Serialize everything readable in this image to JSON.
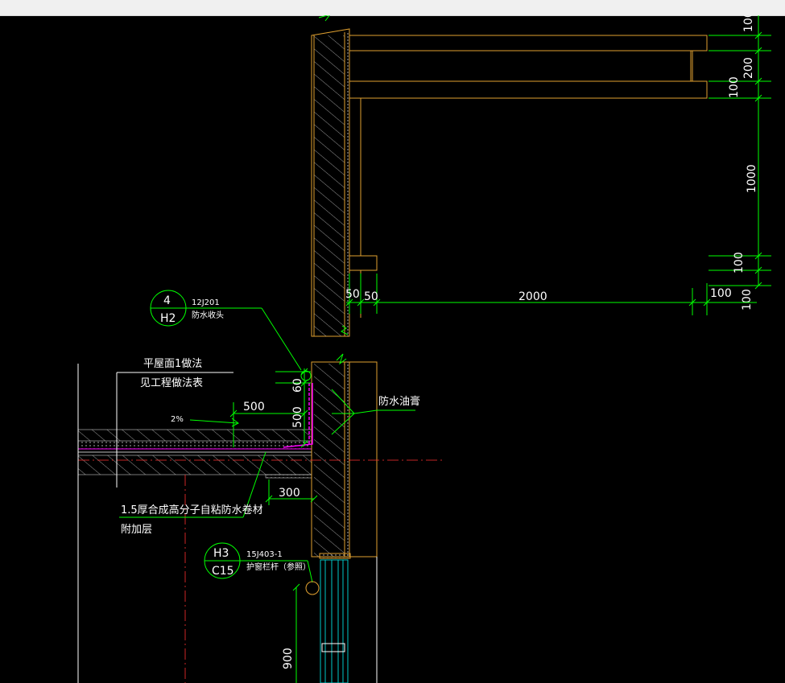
{
  "window": {
    "title_bar": ""
  },
  "colors": {
    "background": "#000000",
    "wall": "#e0a030",
    "hatch": "#c8c8c8",
    "dimension": "#00ff00",
    "leader": "#00ff00",
    "waterproof": "#ff00ff",
    "centerline": "#ff3030"
  },
  "dimensions": {
    "right_100_top": "100",
    "right_200": "200",
    "right_100_a": "100",
    "right_1000": "1000",
    "right_100_b": "100",
    "right_100_c": "100",
    "bottom_50_a": "50",
    "bottom_50_b": "50",
    "bottom_2000": "2000",
    "bottom_100": "100",
    "parapet_60": "60",
    "parapet_500": "500",
    "horiz_500": "500",
    "horiz_300": "300",
    "window_900": "900"
  },
  "callouts": {
    "detail_1": {
      "top": "4",
      "bottom": "H2",
      "ref": "12J201",
      "desc": "防水收头"
    },
    "detail_2": {
      "top": "H3",
      "bottom": "C15",
      "ref": "15J403-1",
      "desc": "护窗栏杆（参照）"
    }
  },
  "notes": {
    "roof_line1": "平屋面1做法",
    "roof_line2": "见工程做法表",
    "slope": "2%",
    "sealant": "防水油膏",
    "membrane_line1": "1.5厚合成高分子自粘防水卷材",
    "membrane_line2": "附加层"
  }
}
